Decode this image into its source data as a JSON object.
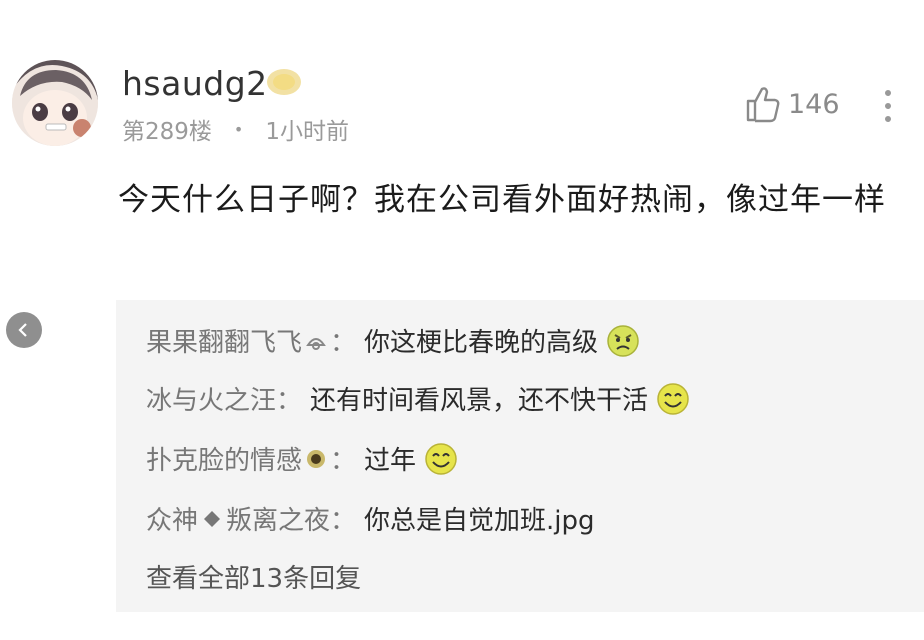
{
  "post": {
    "username": "hsaudg2",
    "floor": "第289楼",
    "time": "1小时前",
    "like_count": "146",
    "content": "今天什么日子啊？我在公司看外面好热闹，像过年一样"
  },
  "replies": [
    {
      "name": "果果翻翻飞飞",
      "text": "你这梗比春晚的高级",
      "emoji": "angry-emoji-icon"
    },
    {
      "name": "冰与火之汪",
      "text": "还有时间看风景，还不快干活",
      "emoji": "smile-emoji-icon"
    },
    {
      "name": "扑克脸的情感",
      "text": "过年",
      "emoji": "smile-emoji-icon"
    },
    {
      "name_part1": "众神",
      "name_part2": "叛离之夜",
      "text": "你总是自觉加班.jpg"
    }
  ],
  "reply_separator": "：",
  "view_all": "查看全部13条回复",
  "icons": {
    "badge": "vip-badge-icon",
    "like": "thumbs-up-icon",
    "more": "more-vertical-icon",
    "back": "chevron-left-icon"
  },
  "colors": {
    "badge": "#e8c95a",
    "reply_background": "#f4f4f4",
    "emoji_face": "#e6e44a"
  }
}
